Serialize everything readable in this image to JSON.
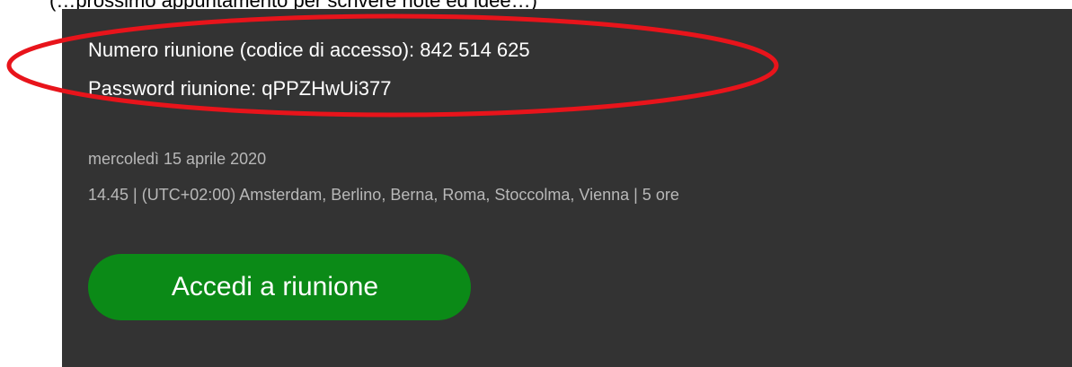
{
  "caption": {
    "text": "(…prossimo appuntamento per scrivere note ed idee…)"
  },
  "meeting": {
    "number_line": "Numero riunione (codice di accesso): 842 514 625",
    "password_line": "Password riunione: qPPZHwUi377",
    "date": "mercoledì 15 aprile 2020",
    "time_line": "14.45  |  (UTC+02:00) Amsterdam, Berlino, Berna, Roma, Stoccolma, Vienna  |  5 ore",
    "join_label": "Accedi a riunione"
  },
  "colors": {
    "panel_background": "#333333",
    "join_button": "#0b8a17",
    "highlight": "#e8141b",
    "secondary_text": "#b8b8b8"
  }
}
